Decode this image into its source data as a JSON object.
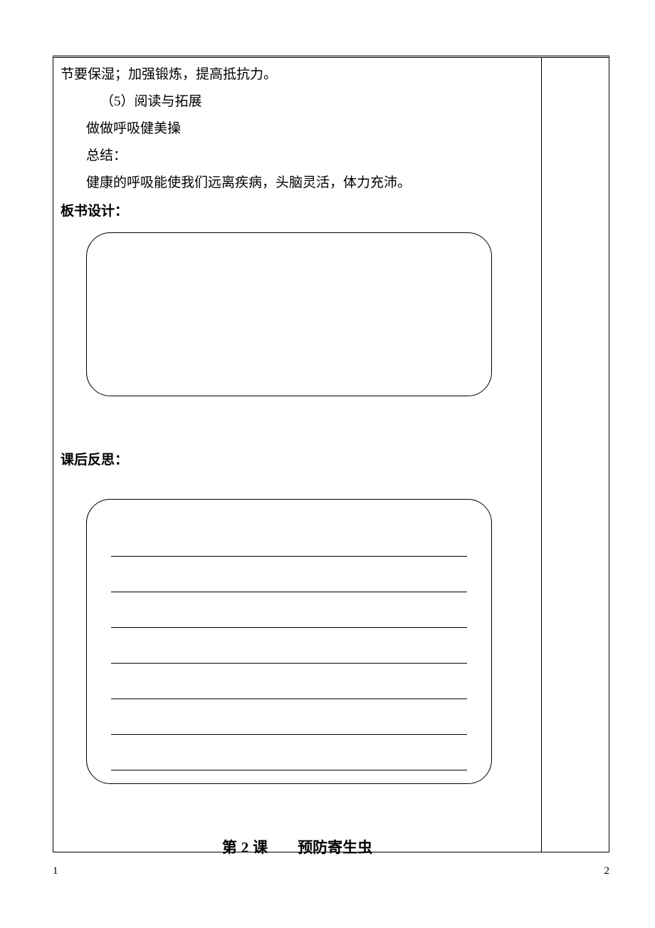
{
  "content": {
    "line1": "节要保湿；加强锻炼，提高抵抗力。",
    "line2": "（5）阅读与拓展",
    "line3": "做做呼吸健美操",
    "line4": "总结：",
    "line5": "健康的呼吸能使我们远离疾病，头脑灵活，体力充沛。"
  },
  "sections": {
    "board_design": "板书设计：",
    "reflection": "课后反思："
  },
  "lesson": {
    "prefix": "第 ",
    "num": "2",
    "mid": " 课",
    "spacer": "　　",
    "title": "预防寄生虫"
  },
  "footer": {
    "left": "1",
    "right": "2"
  }
}
